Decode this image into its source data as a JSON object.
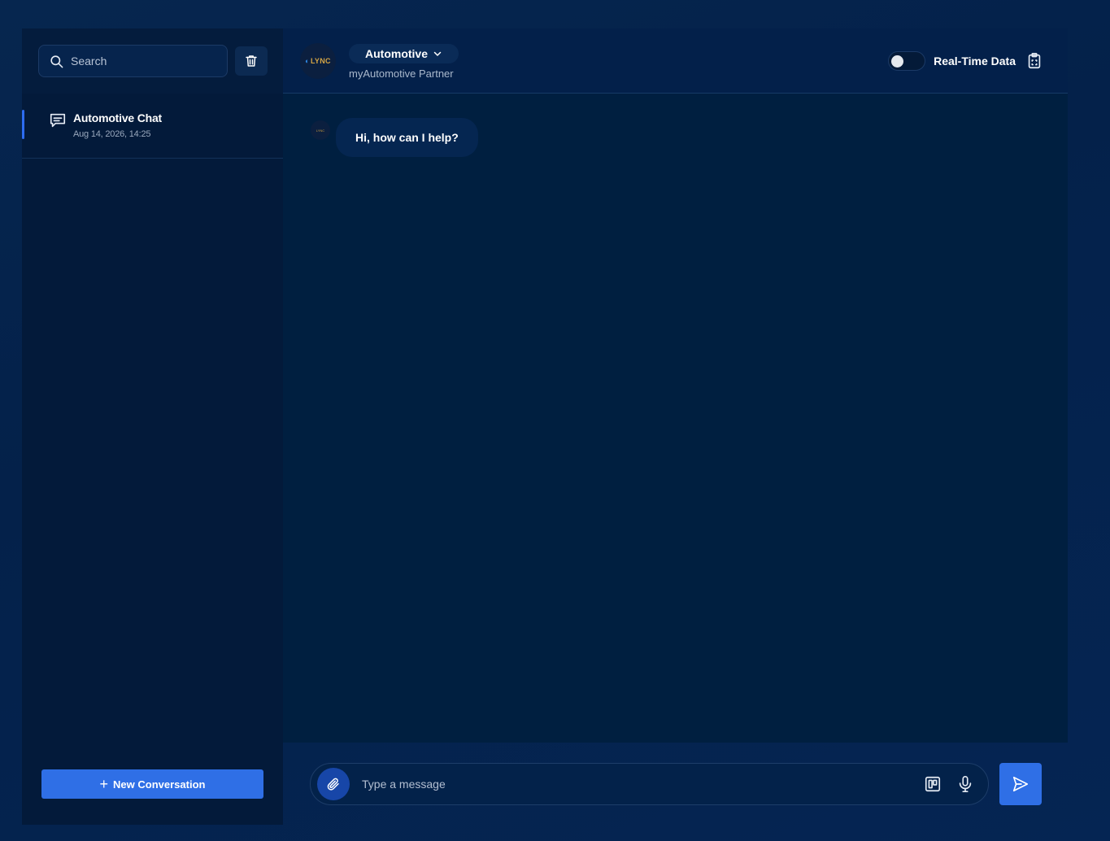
{
  "sidebar": {
    "search": {
      "placeholder": "Search",
      "value": ""
    },
    "conversations": [
      {
        "title": "Automotive Chat",
        "date": "Aug 14, 2026, 14:25"
      }
    ],
    "new_conversation_label": "New Conversation",
    "icons": [
      "search-icon",
      "trash-icon",
      "chat-bubble-icon",
      "plus-icon"
    ]
  },
  "header": {
    "logo_text": "LYNC",
    "agent_name": "Automotive",
    "agent_subtitle": "myAutomotive Partner",
    "realtime_label": "Real-Time Data",
    "realtime_enabled": false
  },
  "chat": {
    "messages": [
      {
        "sender": "assistant",
        "text": "Hi, how can I help?"
      }
    ]
  },
  "composer": {
    "placeholder": "Type a message",
    "value": ""
  },
  "colors": {
    "accent": "#2f6fe6",
    "background": "#04214a",
    "panel": "#001f40",
    "logo_gold": "#d5a545"
  }
}
